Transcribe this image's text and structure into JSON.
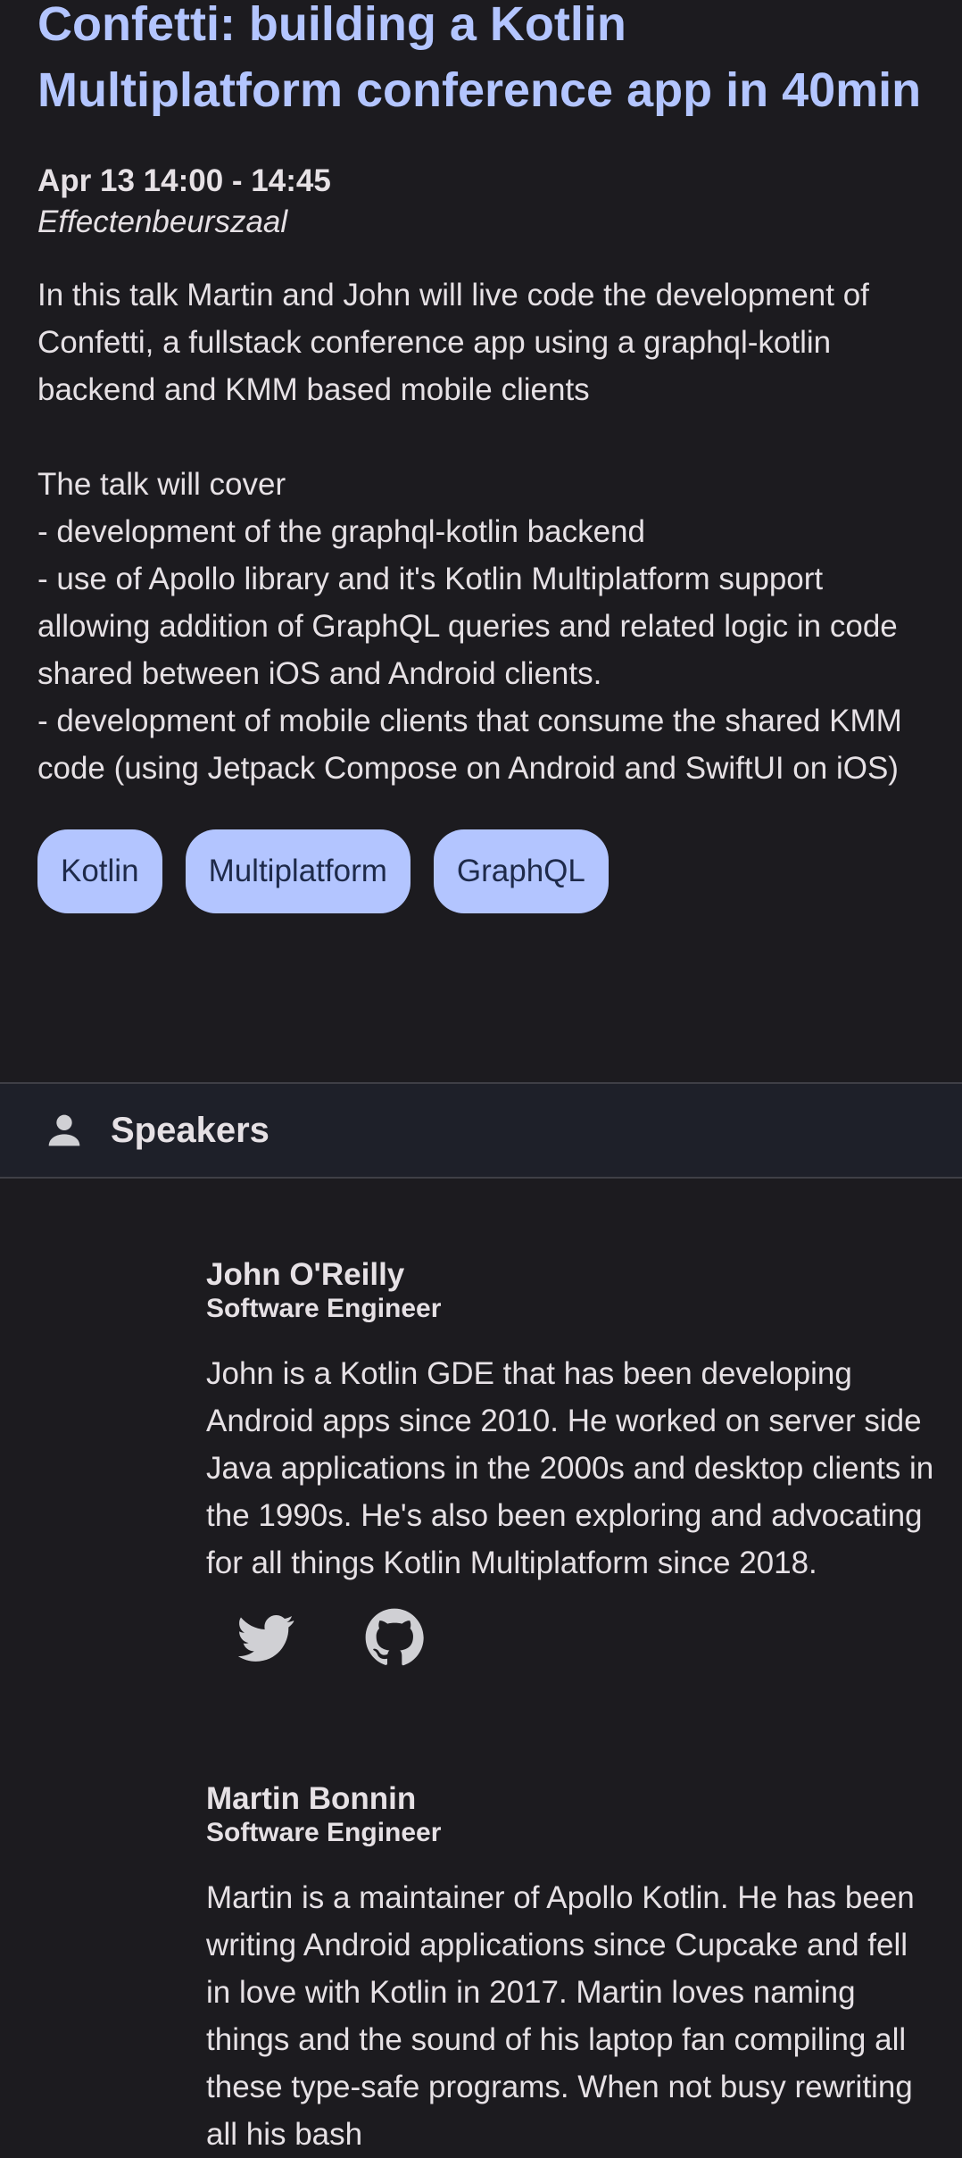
{
  "session": {
    "title": "Confetti: building a Kotlin Multiplatform conference app in 40min",
    "time": "Apr 13 14:00 - 14:45",
    "room": "Effectenbeurszaal",
    "description": "In this talk Martin and John will live code the development of Confetti, a fullstack conference app using a graphql-kotlin backend and KMM based mobile clients\n\nThe talk will cover\n- development of the graphql-kotlin backend\n- use of Apollo library and it's Kotlin Multiplatform support allowing addition of GraphQL queries and related logic in code shared between iOS and Android clients.\n- development of mobile clients that consume the shared KMM code (using Jetpack Compose on Android and SwiftUI on iOS)",
    "tags": [
      "Kotlin",
      "Multiplatform",
      "GraphQL"
    ]
  },
  "speakers_section": {
    "label": "Speakers",
    "icon": "person-icon"
  },
  "speakers": [
    {
      "name": "John O'Reilly",
      "role": "Software Engineer",
      "bio": "John is a Kotlin GDE that has been developing Android apps since 2010. He worked on server side Java applications in the 2000s and desktop clients in the 1990s. He's also been exploring and advocating for all things Kotlin Multiplatform since 2018.",
      "socials": [
        "twitter-icon",
        "github-icon"
      ]
    },
    {
      "name": "Martin Bonnin",
      "role": "Software Engineer",
      "bio": "Martin is a maintainer of Apollo Kotlin. He has been writing Android applications since Cupcake and fell in love with Kotlin in 2017. Martin loves naming things and the sound of his laptop fan compiling all these type-safe programs. When not busy rewriting all his bash"
    }
  ],
  "colors": {
    "background": "#1c1b1f",
    "accent": "#b3c5ff",
    "chip_text": "#1e2a4a",
    "header_bg": "#1e2029",
    "icon": "#d0d0d4"
  }
}
